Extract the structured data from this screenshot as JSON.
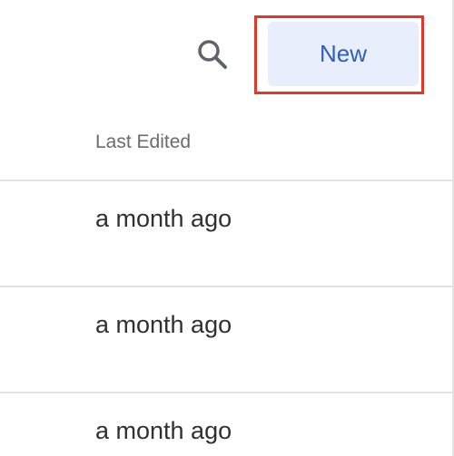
{
  "toolbar": {
    "search_icon": "search-icon",
    "new_label": "New"
  },
  "table": {
    "column_header": "Last Edited",
    "rows": [
      {
        "last_edited": "a month ago"
      },
      {
        "last_edited": "a month ago"
      },
      {
        "last_edited": "a month ago"
      }
    ]
  },
  "colors": {
    "accent": "#2f5fbd",
    "button_bg": "#e8eefb",
    "highlight": "#e0392b"
  }
}
